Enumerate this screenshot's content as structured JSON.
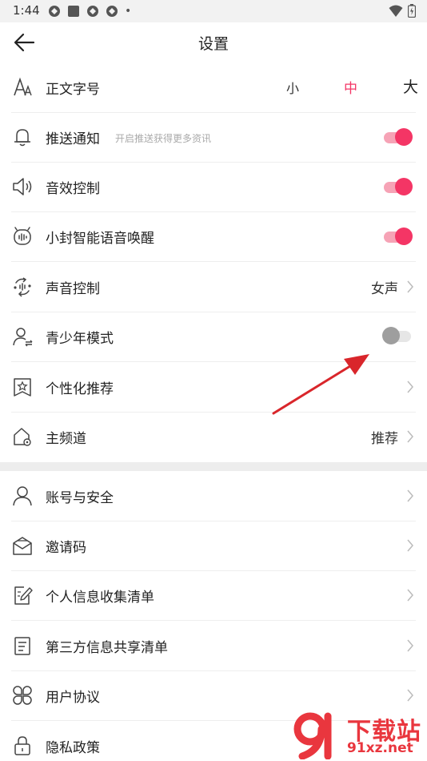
{
  "status": {
    "time": "1:44",
    "dot": "•"
  },
  "header": {
    "title": "设置"
  },
  "font_size": {
    "label": "正文字号",
    "options": [
      "小",
      "中",
      "大"
    ],
    "selected": "中"
  },
  "rows": [
    {
      "label": "推送通知",
      "sub": "开启推送获得更多资讯",
      "toggle": true,
      "icon": "bell-icon"
    },
    {
      "label": "音效控制",
      "toggle": true,
      "icon": "speaker-icon"
    },
    {
      "label": "小封智能语音唤醒",
      "toggle": true,
      "icon": "voice-assistant-icon"
    },
    {
      "label": "声音控制",
      "value": "女声",
      "icon": "voice-control-icon"
    },
    {
      "label": "青少年模式",
      "toggle": false,
      "icon": "youth-mode-icon"
    },
    {
      "label": "个性化推荐",
      "icon": "star-bookmark-icon"
    },
    {
      "label": "主频道",
      "value": "推荐",
      "icon": "home-channel-icon"
    }
  ],
  "section2": [
    {
      "label": "账号与安全",
      "icon": "user-icon"
    },
    {
      "label": "邀请码",
      "icon": "mail-icon"
    },
    {
      "label": "个人信息收集清单",
      "icon": "edit-document-icon"
    },
    {
      "label": "第三方信息共享清单",
      "icon": "list-document-icon"
    },
    {
      "label": "用户协议",
      "icon": "four-petal-icon"
    },
    {
      "label": "隐私政策",
      "icon": "lock-icon"
    }
  ],
  "watermark": {
    "text": "下载站",
    "site": "91xz.net"
  },
  "colors": {
    "accent": "#f43565",
    "accent_light": "#f6a3b6",
    "arrow": "#d9262b"
  }
}
